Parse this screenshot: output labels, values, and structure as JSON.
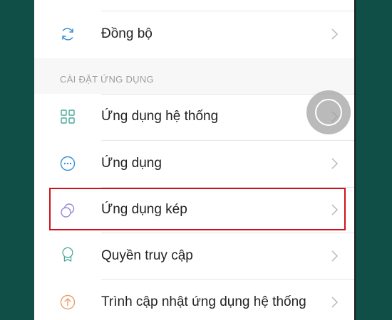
{
  "settings": {
    "top_item": {
      "label": "Đồng bộ",
      "icon": "sync-icon",
      "icon_color": "#3a8fd6"
    },
    "section_title": "CÀI ĐẶT ỨNG DỤNG",
    "items": [
      {
        "label": "Ứng dụng hệ thống",
        "icon": "grid-apps-icon",
        "icon_color": "#4aa89a"
      },
      {
        "label": "Ứng dụng",
        "icon": "more-dots-icon",
        "icon_color": "#3a8fd6"
      },
      {
        "label": "Ứng dụng kép",
        "icon": "dual-circles-icon",
        "icon_color": "#9a86d6",
        "highlighted": true
      },
      {
        "label": "Quyền truy cập",
        "icon": "award-ribbon-icon",
        "icon_color": "#4aa89a"
      },
      {
        "label": "Trình cập nhật ứng dụng hệ thống",
        "icon": "upload-circle-icon",
        "icon_color": "#e8a06a"
      }
    ]
  },
  "colors": {
    "background_frame": "#0f4f48",
    "highlight_border": "#d0101c"
  }
}
